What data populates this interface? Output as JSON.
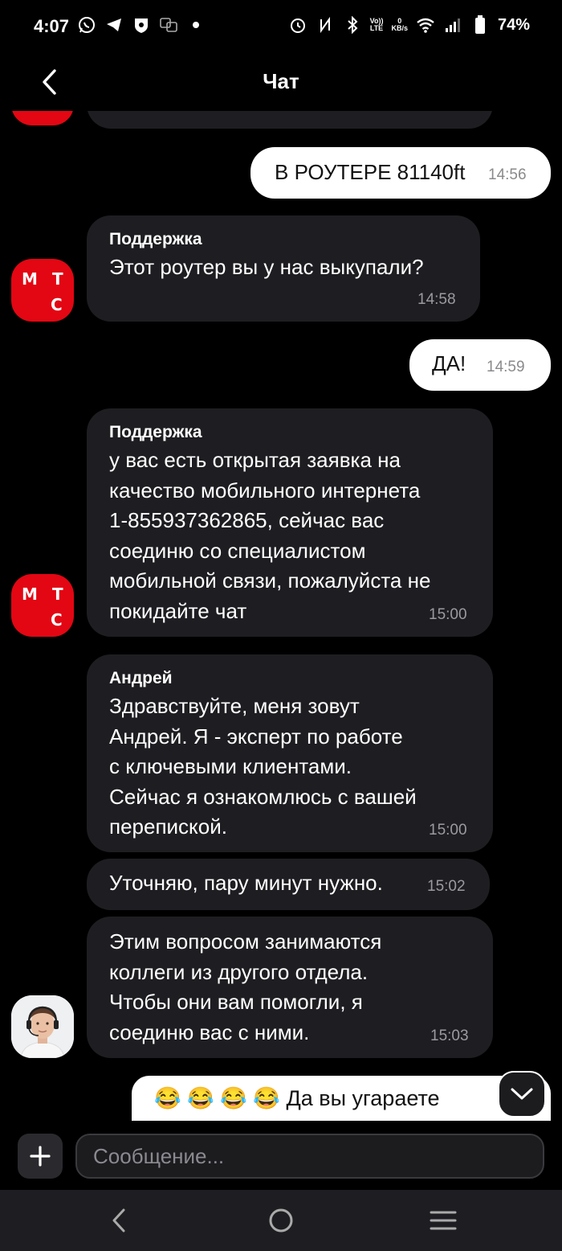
{
  "status_bar": {
    "time": "4:07",
    "network_speed_value": "0",
    "network_speed_unit": "KB/s",
    "volte_line1": "Vo))",
    "volte_line2": "LTE",
    "battery": "74%"
  },
  "header": {
    "title": "Чат"
  },
  "messages": [
    {
      "id": "m1",
      "direction": "outgoing",
      "text": "В РОУТЕРЕ 81140ft",
      "time": "14:56"
    },
    {
      "id": "m2",
      "direction": "incoming",
      "sender": "Поддержка",
      "text": "Этот роутер вы у нас выкупали?",
      "time": "14:58"
    },
    {
      "id": "m3",
      "direction": "outgoing",
      "text": "ДА!",
      "time": "14:59"
    },
    {
      "id": "m4",
      "direction": "incoming",
      "sender": "Поддержка",
      "text": "у вас есть открытая заявка на\nкачество мобильного интернета\n1-855937362865, сейчас вас\nсоединю со специалистом\nмобильной связи, пожалуйста не\nпокидайте чат",
      "time": "15:00"
    },
    {
      "id": "m5",
      "direction": "incoming",
      "sender": "Андрей",
      "text": "Здравствуйте, меня зовут\nАндрей. Я - эксперт по работе\nс ключевыми клиентами.\nСейчас я ознакомлюсь с вашей\nперепиской.",
      "time": "15:00"
    },
    {
      "id": "m6",
      "direction": "incoming",
      "text": "Уточняю, пару минут нужно.",
      "time": "15:02"
    },
    {
      "id": "m7",
      "direction": "incoming",
      "text": "Этим вопросом занимаются\nколлеги из другого отдела.\nЧтобы они вам помогли, я\nсоединю вас с ними.",
      "time": "15:03"
    }
  ],
  "avatars": {
    "mts_letters": [
      "М",
      "Т",
      "С"
    ],
    "brand_color": "#e30613"
  },
  "draft_message": {
    "text": "😂 😂 😂 😂 Да вы угараете"
  },
  "composer": {
    "placeholder": "Сообщение..."
  },
  "colors": {
    "background": "#000000",
    "incoming_bubble": "#1e1e22",
    "outgoing_bubble": "#ffffff"
  }
}
